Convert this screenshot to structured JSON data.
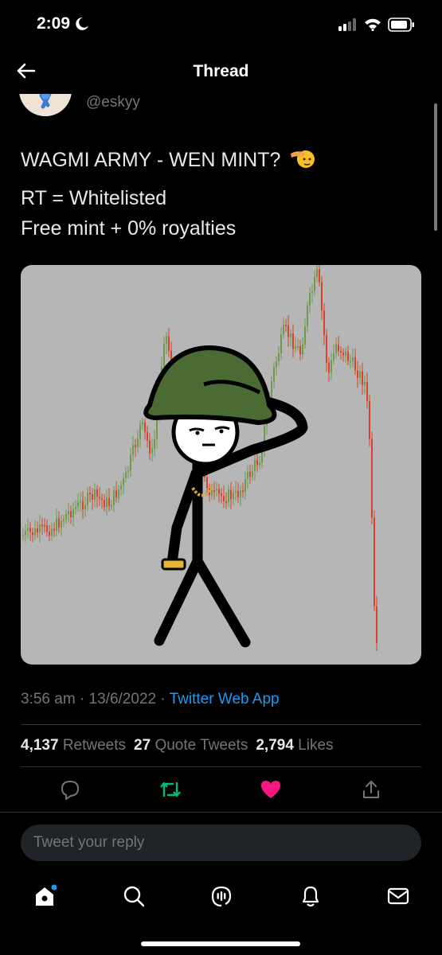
{
  "status_bar": {
    "time": "2:09"
  },
  "header": {
    "title": "Thread"
  },
  "tweet": {
    "handle": "@eskyy",
    "text_line1": "WAGMI ARMY - WEN MINT?",
    "text_line2": "RT = Whitelisted",
    "text_line3": "Free mint + 0% royalties",
    "time": "3:56 am",
    "date": "13/6/2022",
    "source": "Twitter Web App",
    "sep": "·"
  },
  "stats": {
    "retweets_count": "4,137",
    "retweets_label": "Retweets",
    "quotes_count": "27",
    "quotes_label": "Quote Tweets",
    "likes_count": "2,794",
    "likes_label": "Likes"
  },
  "reply": {
    "placeholder": "Tweet your reply"
  },
  "colors": {
    "accent": "#1d9bf0",
    "retweet": "#00ba7c",
    "like": "#f91880",
    "chart_up": "#6e9a4c",
    "chart_down": "#d9412a"
  },
  "icons": [
    "back-arrow-icon",
    "moon-icon",
    "signal-icon",
    "wifi-icon",
    "battery-icon",
    "saluting-face-emoji",
    "reply-icon",
    "retweet-icon",
    "heart-icon",
    "share-icon",
    "home-icon",
    "search-icon",
    "spaces-icon",
    "notifications-icon",
    "messages-icon"
  ]
}
